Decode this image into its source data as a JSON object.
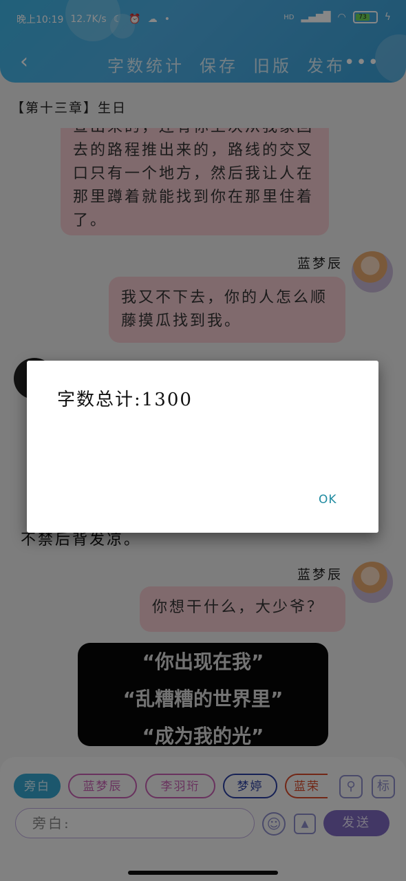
{
  "status_bar": {
    "time": "晚上10:19",
    "speed": "12.7K/s",
    "network": "HD",
    "battery": "73"
  },
  "header": {
    "back_icon": "chevron-left-icon",
    "actions": [
      "字数统计",
      "保存",
      "旧版",
      "发布"
    ],
    "more_icon": "more-dots-icon",
    "accent": "#3fb6e7"
  },
  "chapter_title": "【第十三章】生日",
  "messages": [
    {
      "text": "查出来的，还有你上次从我家回去的路程推出来的，路线的交叉口只有一个地方，然后我让人在那里蹲着就能找到你在那里住着了。"
    },
    {
      "speaker": "蓝梦辰",
      "text": "我又不下去，你的人怎么顺藤摸瓜找到我。"
    },
    {
      "narration": "不禁后背发凉。"
    },
    {
      "speaker": "蓝梦辰",
      "text": "你想干什么，大少爷？"
    }
  ],
  "video_caption": [
    "“你出现在我”",
    "“乱糟糟的世界里”",
    "“成为我的光”"
  ],
  "composer": {
    "chips": [
      "旁白",
      "蓝梦辰",
      "李羽珩",
      "梦婷",
      "蓝荣"
    ],
    "chip_colors": [
      "#36a5cf",
      "#c65fb1",
      "#c65fb1",
      "#2b3fa0",
      "#d84a2a"
    ],
    "right_icons": [
      "person-icon",
      "tag-icon"
    ],
    "tag_label": "标",
    "input_placeholder": "旁白:",
    "send_label": "发送"
  },
  "dialog": {
    "message": "字数总计:1300",
    "ok_label": "OK"
  }
}
